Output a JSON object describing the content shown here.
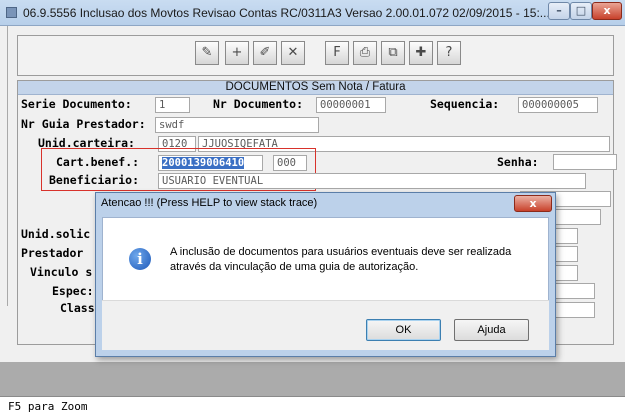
{
  "window": {
    "title": "06.9.5556  Inclusao  dos Movtos Revisao Contas RC/0311A3 Versao 2.00.01.072 02/09/2015 - 15:...",
    "min_label": "–",
    "max_label": "□",
    "close_label": "x"
  },
  "toolbar": {
    "icons": [
      "wrench-icon",
      "add-icon",
      "edit-icon",
      "delete-icon",
      "filter-icon",
      "print-icon",
      "copy-icon",
      "add-page-icon",
      "help-icon"
    ],
    "glyphs": [
      "✎",
      "+",
      "✐",
      "✕",
      "F",
      "⎙",
      "⧉",
      "✚",
      "?"
    ]
  },
  "section_title": "DOCUMENTOS Sem Nota / Fatura",
  "form": {
    "serie_label": "Serie Documento:",
    "serie_value": "1",
    "nr_doc_label": "Nr Documento:",
    "nr_doc_value": "00000001",
    "sequencia_label": "Sequencia:",
    "sequencia_value": "000000005",
    "guia_label": "Nr Guia Prestador:",
    "guia_value": "swdf",
    "unid_carteira_label": "Unid.carteira:",
    "unid_carteira_code": "0120",
    "unid_carteira_name": "JJUOSIQEFATA",
    "cart_benef_label": "Cart.benef.:",
    "cart_benef_value": "2000139006410",
    "cart_benef_suffix": "000",
    "senha_label": "Senha:",
    "beneficiario_label": "Beneficiario:",
    "beneficiario_value": "USUARIO EVENTUAL",
    "unid_solic_label": "Unid.solic",
    "prestador_label": "Prestador",
    "vinculo_label": "Vinculo s",
    "especialidade_label": "Espec:",
    "classe_label": "Class"
  },
  "status_bar": "F5 para Zoom",
  "dialog": {
    "title": "Atencao !!! (Press HELP to view stack trace)",
    "close_label": "x",
    "message": "A inclusão de documentos para usuários eventuais deve ser realizada através da vinculação de uma guia de autorização.",
    "ok_label": "OK",
    "help_label": "Ajuda",
    "icon": "info-icon"
  }
}
